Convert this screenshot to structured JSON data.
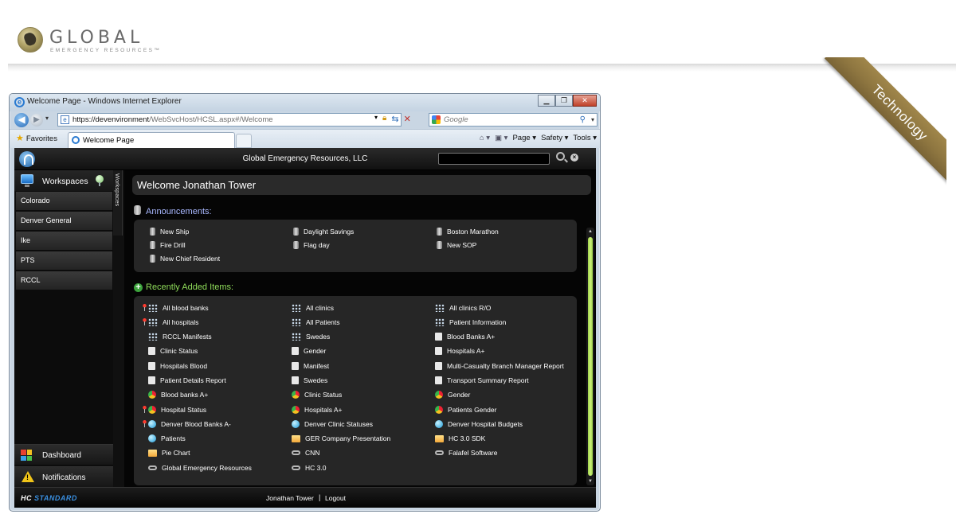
{
  "site": {
    "brand_name": "GLOBAL",
    "brand_sub": "EMERGENCY RESOURCES™",
    "ribbon": "Technology"
  },
  "browser": {
    "window_title": "Welcome Page - Windows Internet Explorer",
    "url_host": "https://devenvironment",
    "url_path": "/WebSvcHost/HCSL.aspx#/Welcome",
    "search_placeholder": "Google",
    "favorites_label": "Favorites",
    "tab_label": "Welcome Page",
    "cmd": {
      "page": "Page ▾",
      "safety": "Safety ▾",
      "tools": "Tools ▾"
    }
  },
  "app": {
    "title": "Global Emergency Resources, LLC",
    "search_value": "",
    "sidebar": {
      "header": "Workspaces",
      "strip_label": "Workspaces",
      "items": [
        "Colorado",
        "Denver General",
        "Ike",
        "PTS",
        "RCCL"
      ],
      "dashboard": "Dashboard",
      "notifications": "Notifications"
    },
    "welcome": "Welcome Jonathan Tower",
    "announcements_title": "Announcements:",
    "announcements": [
      {
        "label": "New Ship",
        "icon": "mic-icon"
      },
      {
        "label": "Daylight Savings",
        "icon": "mic-icon"
      },
      {
        "label": "Boston Marathon",
        "icon": "mic-icon"
      },
      {
        "label": "Fire Drill",
        "icon": "mic-icon"
      },
      {
        "label": "Flag day",
        "icon": "mic-icon"
      },
      {
        "label": "New SOP",
        "icon": "mic-icon"
      },
      {
        "label": "New Chief Resident",
        "icon": "mic-icon"
      }
    ],
    "recent_title": "Recently Added Items:",
    "recent_items": [
      {
        "label": "All blood banks",
        "icon": "net",
        "pinned": true
      },
      {
        "label": "All clinics",
        "icon": "net",
        "pinned": false
      },
      {
        "label": "All clinics R/O",
        "icon": "net",
        "pinned": false
      },
      {
        "label": "All hospitals",
        "icon": "net",
        "pinned": true
      },
      {
        "label": "All Patients",
        "icon": "net",
        "pinned": false
      },
      {
        "label": "Patient Information",
        "icon": "net",
        "pinned": false
      },
      {
        "label": "RCCL Manifests",
        "icon": "net",
        "pinned": false
      },
      {
        "label": "Swedes",
        "icon": "net",
        "pinned": false
      },
      {
        "label": "Blood Banks A+",
        "icon": "doc",
        "pinned": false
      },
      {
        "label": "Clinic Status",
        "icon": "doc",
        "pinned": false
      },
      {
        "label": "Gender",
        "icon": "doc",
        "pinned": false
      },
      {
        "label": "Hospitals A+",
        "icon": "doc",
        "pinned": false
      },
      {
        "label": "Hospitals Blood",
        "icon": "doc",
        "pinned": false
      },
      {
        "label": "Manifest",
        "icon": "doc",
        "pinned": false
      },
      {
        "label": "Multi-Casualty Branch Manager Report",
        "icon": "doc",
        "pinned": false
      },
      {
        "label": "Patient Details Report",
        "icon": "doc",
        "pinned": false
      },
      {
        "label": "Swedes",
        "icon": "doc",
        "pinned": false
      },
      {
        "label": "Transport Summary Report",
        "icon": "doc",
        "pinned": false
      },
      {
        "label": "Blood banks A+",
        "icon": "pie",
        "pinned": false
      },
      {
        "label": "Clinic Status",
        "icon": "pie",
        "pinned": false
      },
      {
        "label": "Gender",
        "icon": "pie",
        "pinned": false
      },
      {
        "label": "Hospital Status",
        "icon": "pie",
        "pinned": true
      },
      {
        "label": "Hospitals A+",
        "icon": "pie",
        "pinned": false
      },
      {
        "label": "Patients Gender",
        "icon": "pie",
        "pinned": false
      },
      {
        "label": "Denver Blood Banks A-",
        "icon": "globe",
        "pinned": true
      },
      {
        "label": "Denver Clinic Statuses",
        "icon": "globe",
        "pinned": false
      },
      {
        "label": "Denver Hospital Budgets",
        "icon": "globe",
        "pinned": false
      },
      {
        "label": "Patients",
        "icon": "globe",
        "pinned": false
      },
      {
        "label": "GER Company Presentation",
        "icon": "folder",
        "pinned": false
      },
      {
        "label": "HC 3.0 SDK",
        "icon": "folder",
        "pinned": false
      },
      {
        "label": "Pie Chart",
        "icon": "folder",
        "pinned": false
      },
      {
        "label": "CNN",
        "icon": "link",
        "pinned": false
      },
      {
        "label": "Falafel Software",
        "icon": "link",
        "pinned": false
      },
      {
        "label": "Global Emergency Resources",
        "icon": "link",
        "pinned": false
      },
      {
        "label": "HC 3.0",
        "icon": "link",
        "pinned": false
      }
    ],
    "footer": {
      "logo_hc": "HC",
      "logo_std": "STANDARD",
      "user": "Jonathan Tower",
      "separator": "|",
      "logout": "Logout"
    }
  },
  "colors": {
    "ribbon": "#8e7640",
    "announcement_title": "#a9b8ff",
    "recent_title": "#8fdc5a",
    "scroll_thumb": "#b6e35f",
    "brand_blue": "#3a8fe0"
  }
}
